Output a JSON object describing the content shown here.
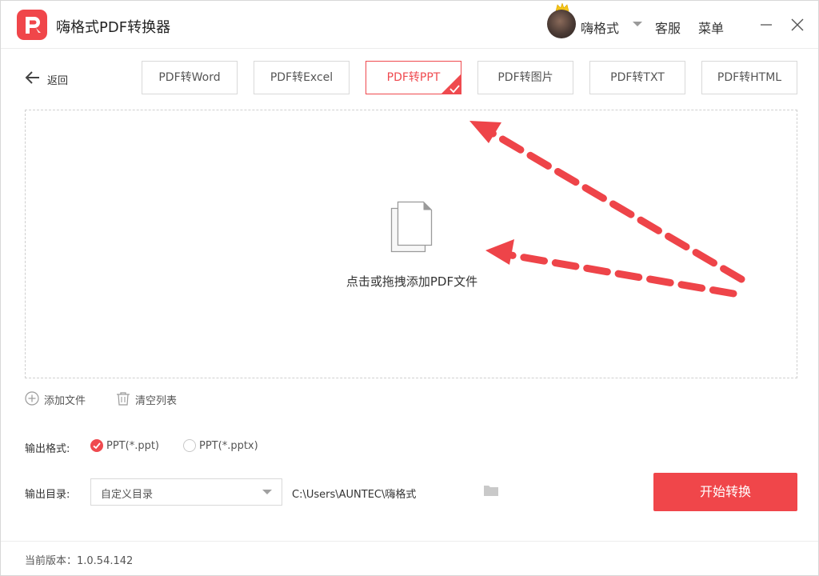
{
  "app": {
    "title": "嗨格式PDF转换器",
    "accent_color": "#f0464a"
  },
  "header": {
    "username": "嗨格式",
    "service_label": "客服",
    "menu_label": "菜单",
    "icons": [
      "logo-icon",
      "crown-icon",
      "chevron-down-icon",
      "minimize-icon",
      "close-icon"
    ]
  },
  "nav": {
    "back_label": "返回",
    "tabs": [
      {
        "label": "PDF转Word",
        "active": false
      },
      {
        "label": "PDF转Excel",
        "active": false
      },
      {
        "label": "PDF转PPT",
        "active": true
      },
      {
        "label": "PDF转图片",
        "active": false
      },
      {
        "label": "PDF转TXT",
        "active": false
      },
      {
        "label": "PDF转HTML",
        "active": false
      }
    ]
  },
  "dropzone": {
    "prompt": "点击或拖拽添加PDF文件",
    "icon": "document-icon"
  },
  "actions": {
    "add_file_label": "添加文件",
    "clear_list_label": "清空列表"
  },
  "output_format": {
    "label": "输出格式:",
    "options": [
      {
        "label": "PPT(*.ppt)",
        "selected": true
      },
      {
        "label": "PPT(*.pptx)",
        "selected": false
      }
    ]
  },
  "output_dir": {
    "label": "输出目录:",
    "selected": "自定义目录",
    "path": "C:\\Users\\AUNTEC\\嗨格式"
  },
  "start_button_label": "开始转换",
  "footer": {
    "version_text": "当前版本：1.0.54.142"
  }
}
